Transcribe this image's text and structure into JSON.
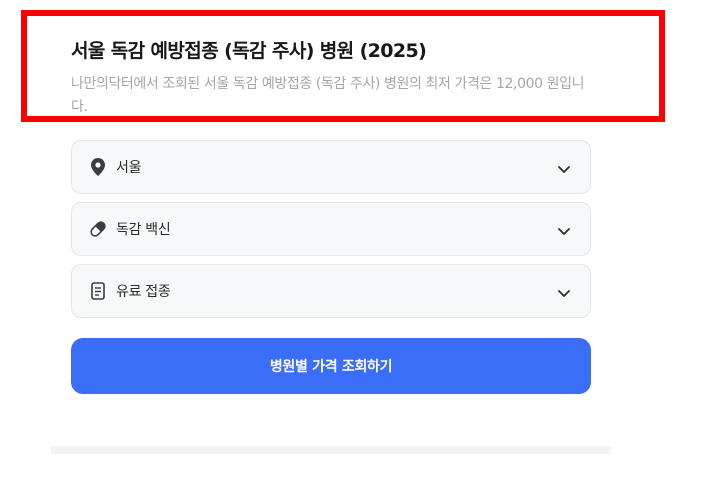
{
  "header": {
    "title": "서울 독감 예방접종 (독감 주사) 병원 (2025)",
    "description": "나만의닥터에서 조회된 서울 독감 예방접종 (독감 주사) 병원의 최저 가격은 12,000 원입니다."
  },
  "filters": [
    {
      "label": "서울",
      "icon": "location-pin-icon"
    },
    {
      "label": "독감 백신",
      "icon": "pill-icon"
    },
    {
      "label": "유료 접종",
      "icon": "document-icon"
    }
  ],
  "cta": {
    "label": "병원별 가격 조회하기"
  },
  "colors": {
    "highlight": "#ff0000",
    "primary": "#3a6ef7",
    "field_bg": "#f7f8fa",
    "muted_text": "#a3a6ad"
  }
}
